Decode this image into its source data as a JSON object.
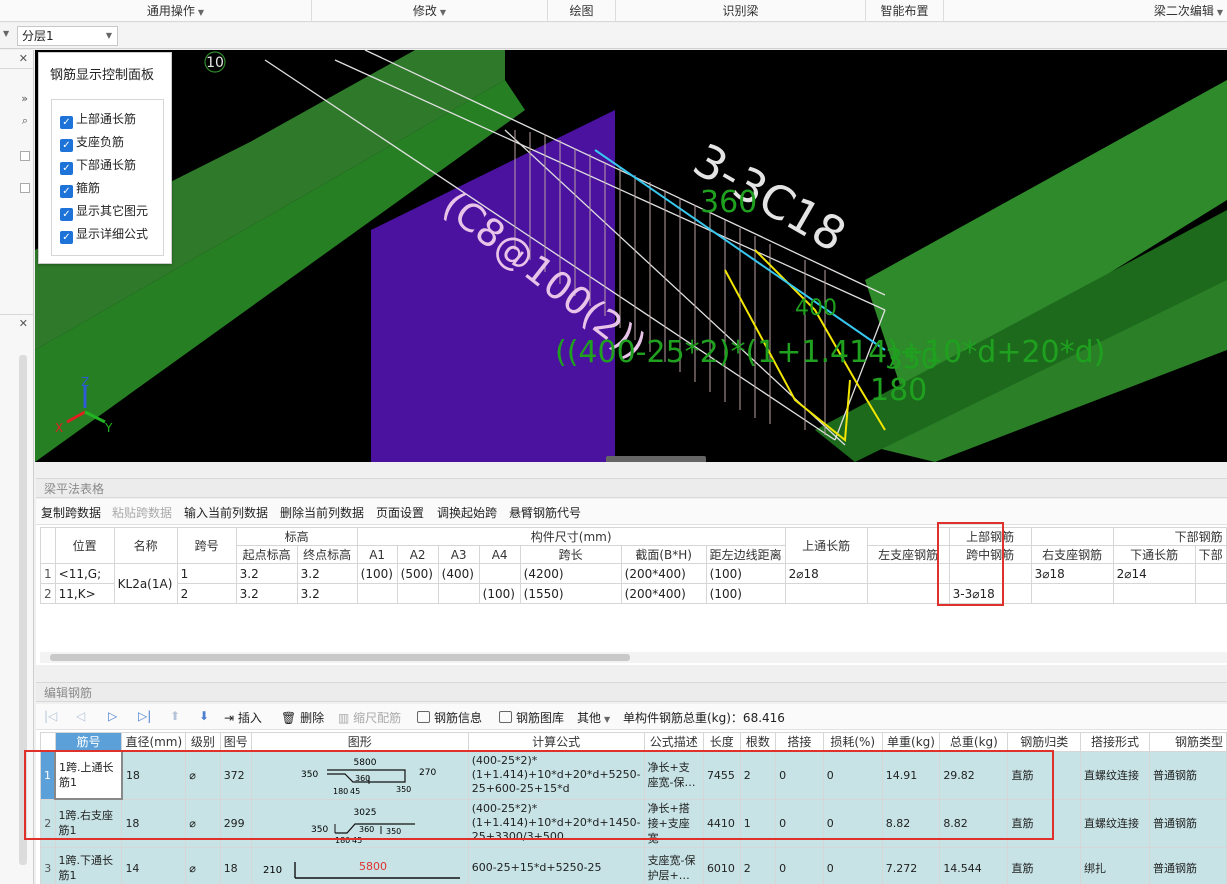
{
  "ribbon": {
    "groups": [
      "通用操作",
      "修改",
      "绘图",
      "识别梁",
      "智能布置",
      "梁二次编辑"
    ]
  },
  "floor": {
    "selected": "分层1"
  },
  "viewport": {
    "label_circle": "10",
    "label_3c18": "3-3C18",
    "label_stirrup": "(C8@100(2))",
    "label_360": "360",
    "label_400": "400",
    "label_formula": "((400-25*2)*(1+1.414)+10*d+20*d)",
    "label_350": "350",
    "label_180": "180",
    "axis_x": "X",
    "axis_y": "Y",
    "axis_z": "Z"
  },
  "control_panel": {
    "title": "钢筋显示控制面板",
    "items": [
      "上部通长筋",
      "支座负筋",
      "下部通长筋",
      "箍筋",
      "显示其它图元",
      "显示详细公式"
    ]
  },
  "beam_section": {
    "title": "梁平法表格",
    "toolbar": [
      "复制跨数据",
      "粘贴跨数据",
      "输入当前列数据",
      "删除当前列数据",
      "页面设置",
      "调换起始跨",
      "悬臂钢筋代号"
    ],
    "headers": {
      "position": "位置",
      "name": "名称",
      "span_no": "跨号",
      "elevation": "标高",
      "start_elev": "起点标高",
      "end_elev": "终点标高",
      "size_group": "构件尺寸(mm)",
      "a1": "A1",
      "a2": "A2",
      "a3": "A3",
      "a4": "A4",
      "span_len": "跨长",
      "section": "截面(B*H)",
      "edge_dist": "距左边线距离",
      "top_through": "上通长筋",
      "left_support": "左支座钢筋",
      "top_rebar": "上部钢筋",
      "mid_span": "跨中钢筋",
      "right_support": "右支座钢筋",
      "bottom_rebar": "下部钢筋",
      "bottom_through": "下通长筋",
      "bottom_more": "下部"
    },
    "rows": [
      {
        "num": "1",
        "pos": "<11,G;",
        "name": "KL2a(1A)",
        "span": "1",
        "start": "3.2",
        "end": "3.2",
        "a1": "(100)",
        "a2": "(500)",
        "a3": "(400)",
        "a4": "",
        "len": "(4200)",
        "sec": "(200*400)",
        "dist": "(100)",
        "top": "2⌀18",
        "left": "",
        "mid": "",
        "right": "3⌀18",
        "bot": "2⌀14"
      },
      {
        "num": "2",
        "pos": "11,K>",
        "name": "",
        "span": "2",
        "start": "3.2",
        "end": "3.2",
        "a1": "",
        "a2": "",
        "a3": "",
        "a4": "(100)",
        "len": "(1550)",
        "sec": "(200*400)",
        "dist": "(100)",
        "top": "",
        "left": "",
        "mid": "3-3⌀18",
        "right": "",
        "bot": ""
      }
    ]
  },
  "rebar_section": {
    "title": "编辑钢筋",
    "toolbar": {
      "insert": "插入",
      "delete": "删除",
      "scale": "缩尺配筋",
      "info": "钢筋信息",
      "library": "钢筋图库",
      "other": "其他",
      "total_weight": "单构件钢筋总重(kg)：68.416"
    },
    "headers": [
      "筋号",
      "直径(mm)",
      "级别",
      "图号",
      "图形",
      "计算公式",
      "公式描述",
      "长度",
      "根数",
      "搭接",
      "损耗(%)",
      "单重(kg)",
      "总重(kg)",
      "钢筋归类",
      "搭接形式",
      "钢筋类型"
    ],
    "rows": [
      {
        "num": "1",
        "name": "1跨.上通长筋1",
        "dia": "18",
        "grade": "⌀",
        "fig": "372",
        "shape": {
          "left": "350",
          "top": "5800",
          "right": "270",
          "mid": "360",
          "s1": "180",
          "s2": "45",
          "s3": "350"
        },
        "formula": "(400-25*2)*(1+1.414)+10*d+20*d+5250-25+600-25+15*d",
        "desc": "净长+支座宽-保…",
        "len": "7455",
        "count": "2",
        "lap": "0",
        "loss": "0",
        "unit": "14.91",
        "total": "29.82",
        "cat": "直筋",
        "lap_type": "直螺纹连接",
        "type": "普通钢筋"
      },
      {
        "num": "2",
        "name": "1跨.右支座筋1",
        "dia": "18",
        "grade": "⌀",
        "fig": "299",
        "shape": {
          "left": "350",
          "top": "3025",
          "right": "",
          "mid": "360",
          "s1": "180",
          "s2": "45",
          "s3": "350"
        },
        "formula": "(400-25*2)*(1+1.414)+10*d+20*d+1450-25+3300/3+500",
        "desc": "净长+搭接+支座宽",
        "len": "4410",
        "count": "1",
        "lap": "0",
        "loss": "0",
        "unit": "8.82",
        "total": "8.82",
        "cat": "直筋",
        "lap_type": "直螺纹连接",
        "type": "普通钢筋"
      },
      {
        "num": "3",
        "name": "1跨.下通长筋1",
        "dia": "14",
        "grade": "⌀",
        "fig": "18",
        "shape": {
          "left": "210",
          "top": "5800"
        },
        "formula": "600-25+15*d+5250-25",
        "desc": "支座宽-保护层+…",
        "len": "6010",
        "count": "2",
        "lap": "0",
        "loss": "0",
        "unit": "7.272",
        "total": "14.544",
        "cat": "直筋",
        "lap_type": "绑扎",
        "type": "普通钢筋"
      }
    ]
  },
  "colors": {
    "highlight_red": "#e0302c",
    "row_bg": "#c7e3e6",
    "accent_blue": "#1e73d8",
    "green_text": "#1fa11f"
  }
}
